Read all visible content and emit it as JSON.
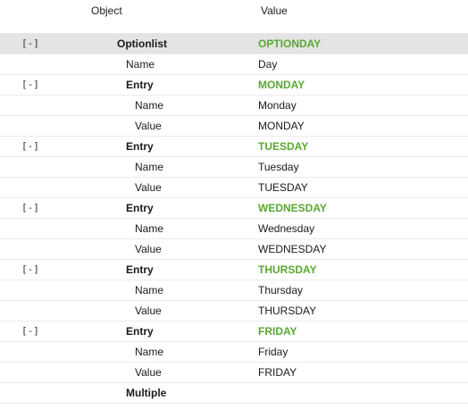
{
  "columns": {
    "object": "Object",
    "value": "Value"
  },
  "colors": {
    "accent_green": "#5aa832",
    "selected_row": "#e4e4e4"
  },
  "rows": [
    {
      "toggle": "[-]",
      "object": "Optionlist",
      "value": "OPTIONDAY",
      "kind": "root"
    },
    {
      "toggle": "",
      "object": "Name",
      "value": "Day",
      "kind": "root-prop"
    },
    {
      "toggle": "[-]",
      "object": "Entry",
      "value": "MONDAY",
      "kind": "entry"
    },
    {
      "toggle": "",
      "object": "Name",
      "value": "Monday",
      "kind": "prop"
    },
    {
      "toggle": "",
      "object": "Value",
      "value": "MONDAY",
      "kind": "prop"
    },
    {
      "toggle": "[-]",
      "object": "Entry",
      "value": "TUESDAY",
      "kind": "entry"
    },
    {
      "toggle": "",
      "object": "Name",
      "value": "Tuesday",
      "kind": "prop"
    },
    {
      "toggle": "",
      "object": "Value",
      "value": "TUESDAY",
      "kind": "prop"
    },
    {
      "toggle": "[-]",
      "object": "Entry",
      "value": "WEDNESDAY",
      "kind": "entry"
    },
    {
      "toggle": "",
      "object": "Name",
      "value": "Wednesday",
      "kind": "prop"
    },
    {
      "toggle": "",
      "object": "Value",
      "value": "WEDNESDAY",
      "kind": "prop"
    },
    {
      "toggle": "[-]",
      "object": "Entry",
      "value": "THURSDAY",
      "kind": "entry"
    },
    {
      "toggle": "",
      "object": "Name",
      "value": "Thursday",
      "kind": "prop"
    },
    {
      "toggle": "",
      "object": "Value",
      "value": "THURSDAY",
      "kind": "prop"
    },
    {
      "toggle": "[-]",
      "object": "Entry",
      "value": "FRIDAY",
      "kind": "entry"
    },
    {
      "toggle": "",
      "object": "Name",
      "value": "Friday",
      "kind": "prop"
    },
    {
      "toggle": "",
      "object": "Value",
      "value": "FRIDAY",
      "kind": "prop"
    },
    {
      "toggle": "",
      "object": "Multiple",
      "value": "",
      "kind": "entry"
    }
  ]
}
